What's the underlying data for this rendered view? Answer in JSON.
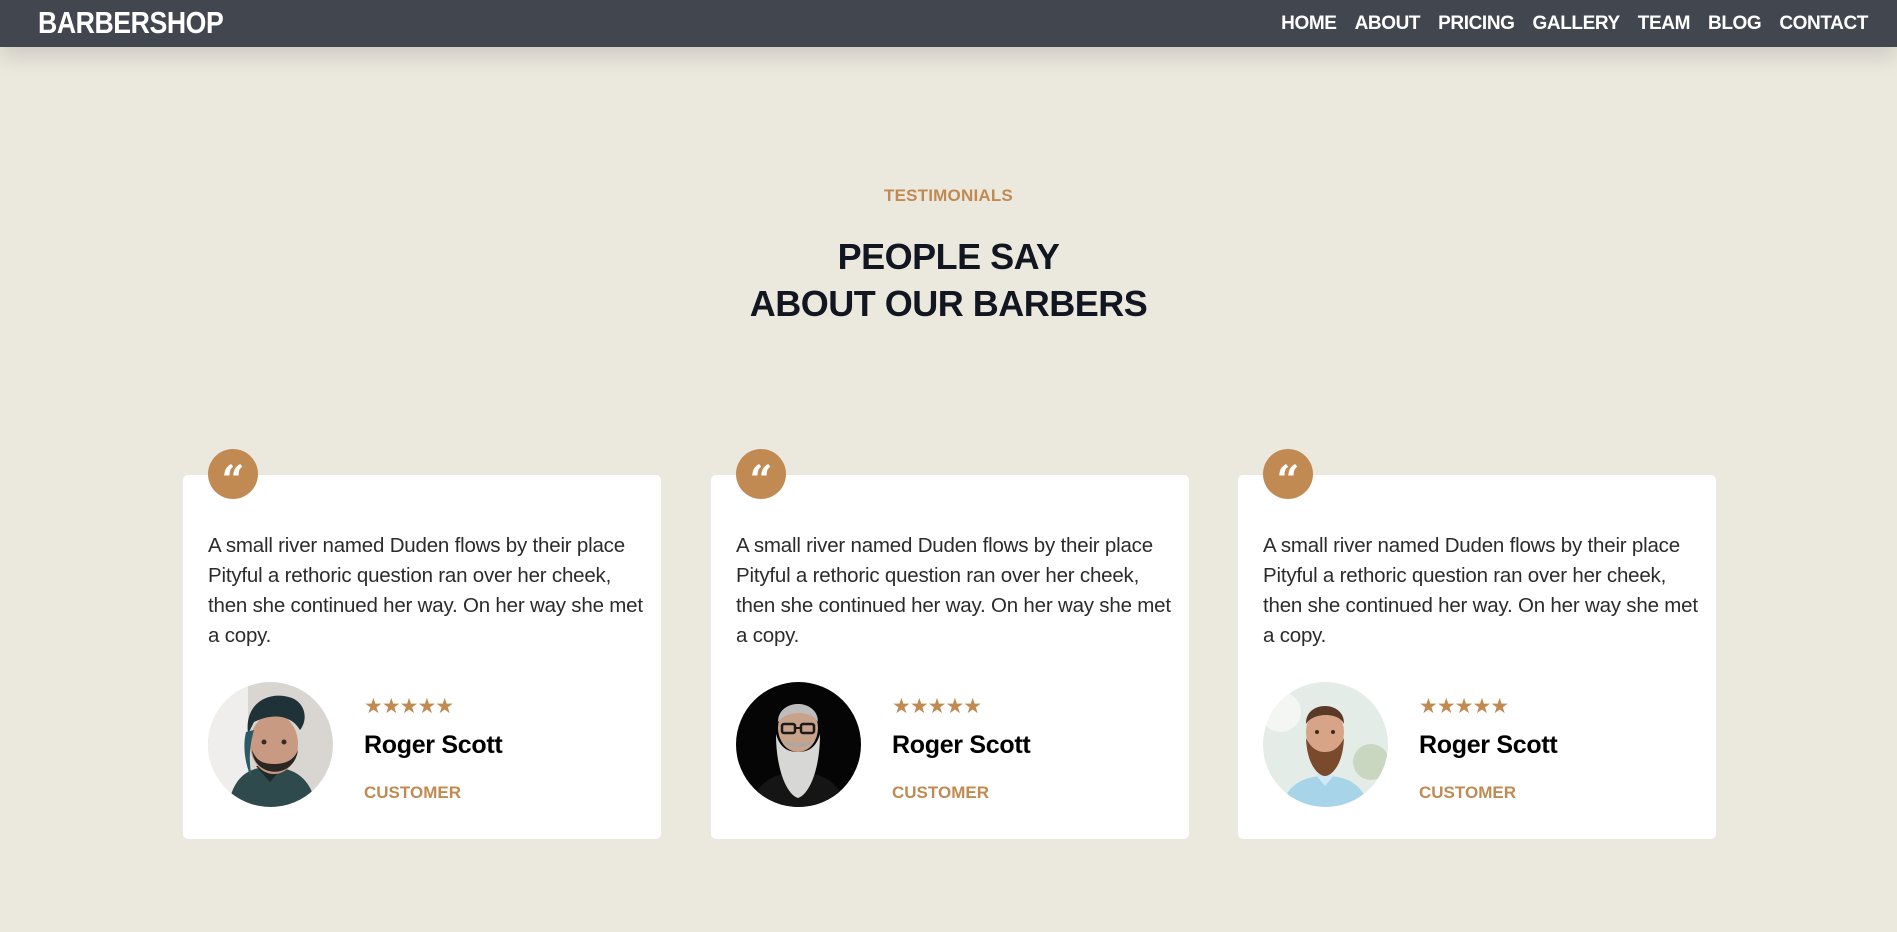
{
  "navbar": {
    "brand": "BARBERSHOP",
    "items": [
      "HOME",
      "ABOUT",
      "PRICING",
      "GALLERY",
      "TEAM",
      "BLOG",
      "CONTACT"
    ]
  },
  "section": {
    "eyebrow": "TESTIMONIALS",
    "heading_line1": "PEOPLE SAY",
    "heading_line2": "ABOUT OUR BARBERS"
  },
  "testimonials": [
    {
      "quote_icon": "quote-icon",
      "text": "A small river named Duden flows by their place Pityful a rethoric question ran over her cheek, then she continued her way. On her way she met a copy.",
      "rating": 5,
      "stars": "★★★★★",
      "name": "Roger Scott",
      "role": "CUSTOMER"
    },
    {
      "quote_icon": "quote-icon",
      "text": "A small river named Duden flows by their place Pityful a rethoric question ran over her cheek, then she continued her way. On her way she met a copy.",
      "rating": 5,
      "stars": "★★★★★",
      "name": "Roger Scott",
      "role": "CUSTOMER"
    },
    {
      "quote_icon": "quote-icon",
      "text": "A small river named Duden flows by their place Pityful a rethoric question ran over her cheek, then she continued her way. On her way she met a copy.",
      "rating": 5,
      "stars": "★★★★★",
      "name": "Roger Scott",
      "role": "CUSTOMER"
    }
  ],
  "colors": {
    "background": "#ebe8de",
    "navbar": "#42464f",
    "accent": "#c08a52",
    "heading": "#121620",
    "card": "#ffffff"
  }
}
